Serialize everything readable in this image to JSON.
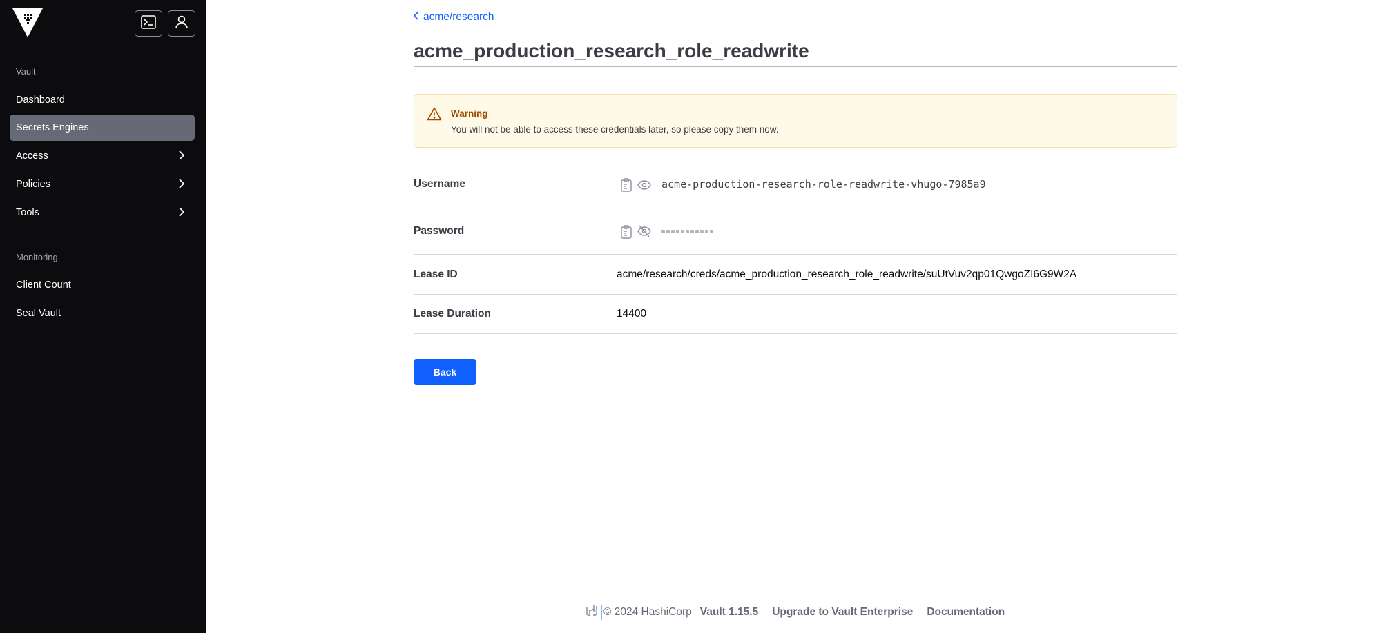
{
  "sidebar": {
    "sections": [
      {
        "heading": "Vault"
      },
      {
        "heading": "Monitoring"
      }
    ],
    "items": [
      {
        "label": "Dashboard"
      },
      {
        "label": "Secrets Engines"
      },
      {
        "label": "Access"
      },
      {
        "label": "Policies"
      },
      {
        "label": "Tools"
      },
      {
        "label": "Client Count"
      },
      {
        "label": "Seal Vault"
      }
    ],
    "active_item": "Secrets Engines",
    "icons": {
      "logo": "vault-logo-icon",
      "console": "terminal-icon",
      "user": "user-icon",
      "expand": "chevron-right-icon"
    }
  },
  "breadcrumb": {
    "label": "acme/research"
  },
  "page": {
    "title": "acme_production_research_role_readwrite"
  },
  "alert": {
    "title": "Warning",
    "message": "You will not be able to access these credentials later, so please copy them now.",
    "icon": "alert-triangle-icon"
  },
  "credentials": {
    "username": {
      "label": "Username",
      "value": "acme-production-research-role-readwrite-vhugo-7985a9"
    },
    "password": {
      "label": "Password",
      "masked": "•••••••••••"
    },
    "lease_id": {
      "label": "Lease ID",
      "value": "acme/research/creds/acme_production_research_role_readwrite/suUtVuv2qp01QwgoZI6G9W2A"
    },
    "lease_duration": {
      "label": "Lease Duration",
      "value": "14400"
    }
  },
  "actions": {
    "back_label": "Back"
  },
  "footer": {
    "copyright": "© 2024 HashiCorp",
    "version": "Vault 1.15.5",
    "upgrade": "Upgrade to Vault Enterprise",
    "docs": "Documentation"
  },
  "colors": {
    "sidebar_bg": "#0c0c0e",
    "active_nav": "#656a76",
    "primary": "#1060ff",
    "warning_bg": "#fff9e8",
    "warning_text": "#9e4b00"
  }
}
